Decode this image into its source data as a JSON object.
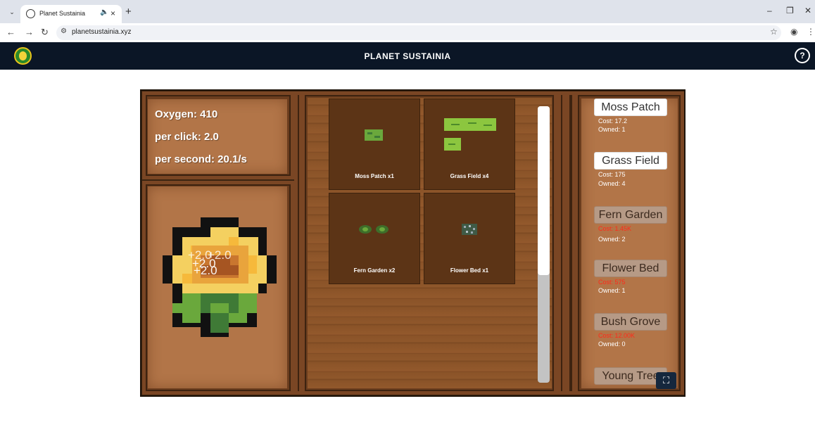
{
  "browser": {
    "tab_title": "Planet Sustainia",
    "url": "planetsustainia.xyz",
    "new_tab_label": "+",
    "minimize_label": "–",
    "restore_label": "❐",
    "close_label": "✕"
  },
  "site": {
    "title": "PLANET SUSTAINIA",
    "help_label": "?"
  },
  "stats": {
    "oxygen": "Oxygen: 410",
    "per_click": "per click: 2.0",
    "per_second": "per second: 20.1/s"
  },
  "clicker": {
    "floaters": [
      "+2.0",
      "+2.0",
      "+2.0",
      "+2.0"
    ]
  },
  "plots": [
    {
      "label": "Moss Patch x1"
    },
    {
      "label": "Grass Field x4"
    },
    {
      "label": "Fern Garden x2"
    },
    {
      "label": "Flower Bed x1"
    }
  ],
  "scroll": {
    "position_fraction": 0.0,
    "visible_fraction": 0.61
  },
  "shop": [
    {
      "name": "Moss Patch",
      "cost": "Cost: 17.2",
      "owned": "Owned: 1",
      "affordable": true
    },
    {
      "name": "Grass Field",
      "cost": "Cost: 175",
      "owned": "Owned: 4",
      "affordable": true
    },
    {
      "name": "Fern Garden",
      "cost": "Cost: 1.45K",
      "owned": "Owned: 2",
      "affordable": false
    },
    {
      "name": "Flower Bed",
      "cost": "Cost: 575",
      "owned": "Owned: 1",
      "affordable": false
    },
    {
      "name": "Bush Grove",
      "cost": "Cost: 12.00K",
      "owned": "Owned: 0",
      "affordable": false
    },
    {
      "name": "Young Tree",
      "affordable": false
    }
  ],
  "colors": {
    "header_bg": "#0b1626",
    "wood": "#b27548",
    "cost_unaffordable": "#ff2a1a"
  },
  "icons": {
    "fullscreen": "fullscreen-icon",
    "help": "help-icon"
  }
}
